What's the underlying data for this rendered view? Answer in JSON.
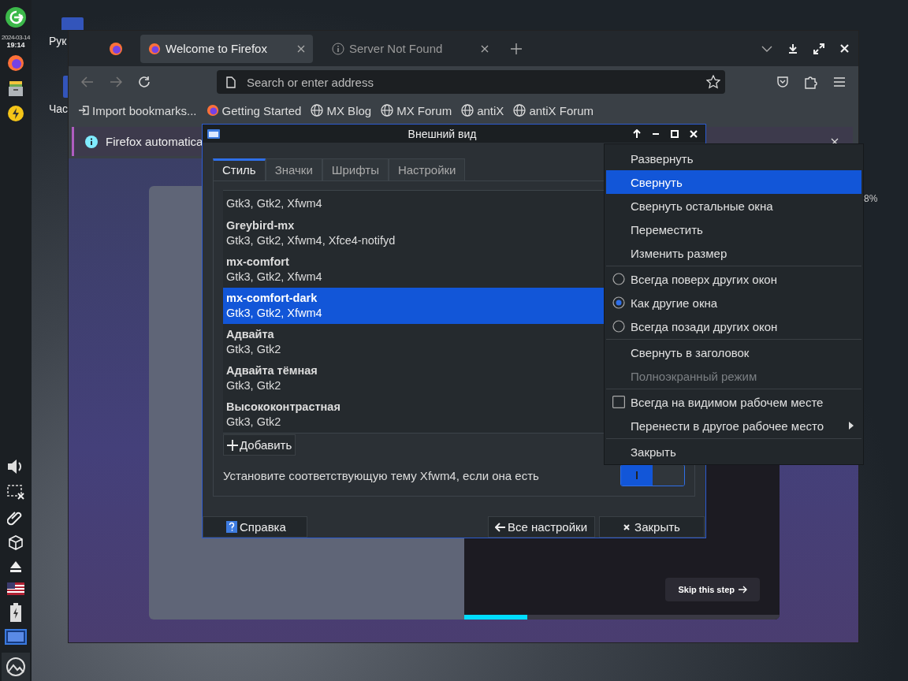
{
  "panel": {
    "date": "2024-03-14",
    "time": "19:14"
  },
  "desktop_icons": [
    {
      "label": "Рук"
    },
    {
      "label": "Час"
    }
  ],
  "desktop_reading": "8%",
  "browser": {
    "tabs": [
      {
        "title": "Welcome to Firefox",
        "selected": true
      },
      {
        "title": "Server Not Found",
        "selected": false
      }
    ],
    "address": {
      "placeholder": "Search or enter address"
    },
    "bookmarks": [
      {
        "label": "Import bookmarks...",
        "kind": "import"
      },
      {
        "label": "Getting Started",
        "kind": "firefox"
      },
      {
        "label": "MX Blog",
        "kind": "globe"
      },
      {
        "label": "MX Forum",
        "kind": "globe"
      },
      {
        "label": "antiX",
        "kind": "globe"
      },
      {
        "label": "antiX Forum",
        "kind": "globe"
      }
    ],
    "notification": "Firefox automatica",
    "skip_button": "Skip this step",
    "progress": {
      "level": 0.2
    }
  },
  "dialog": {
    "title": "Внешний вид",
    "tabs": [
      {
        "label": "Стиль",
        "selected": true
      },
      {
        "label": "Значки",
        "selected": false
      },
      {
        "label": "Шрифты",
        "selected": false
      },
      {
        "label": "Настройки",
        "selected": false
      }
    ],
    "themes": [
      {
        "components": "Gtk3, Gtk2, Xfwm4",
        "selected": false
      },
      {
        "name": "Greybird-mx",
        "components": "Gtk3, Gtk2, Xfwm4, Xfce4-notifyd",
        "selected": false
      },
      {
        "name": "mx-comfort",
        "components": "Gtk3, Gtk2, Xfwm4",
        "selected": false
      },
      {
        "name": "mx-comfort-dark",
        "components": "Gtk3, Gtk2, Xfwm4",
        "selected": true
      },
      {
        "name": "Адвайта",
        "components": "Gtk3, Gtk2",
        "selected": false
      },
      {
        "name": "Адвайта тёмная",
        "components": "Gtk3, Gtk2",
        "selected": false
      },
      {
        "name": "Высококонтрастная",
        "components": "Gtk3, Gtk2",
        "selected": false
      }
    ],
    "add_button": "Добавить",
    "xfwm_option": {
      "label": "Установите соответствующую тему Xfwm4, если она есть",
      "on": true
    },
    "buttons": {
      "help": "Справка",
      "all_settings": "Все настройки",
      "close": "Закрыть"
    }
  },
  "menu": [
    {
      "kind": "item",
      "label": "Развернуть",
      "selected": false,
      "disabled": false
    },
    {
      "kind": "item",
      "label": "Свернуть",
      "selected": true,
      "disabled": false
    },
    {
      "kind": "item",
      "label": "Свернуть остальные окна",
      "selected": false,
      "disabled": false
    },
    {
      "kind": "item",
      "label": "Переместить",
      "selected": false,
      "disabled": false
    },
    {
      "kind": "item",
      "label": "Изменить размер",
      "selected": false,
      "disabled": false
    },
    {
      "kind": "separator"
    },
    {
      "kind": "radio",
      "label": "Всегда поверх других окон",
      "checked": false,
      "selected": false,
      "disabled": false
    },
    {
      "kind": "radio",
      "label": "Как другие окна",
      "checked": true,
      "selected": false,
      "disabled": false
    },
    {
      "kind": "radio",
      "label": "Всегда позади других окон",
      "checked": false,
      "selected": false,
      "disabled": false
    },
    {
      "kind": "separator"
    },
    {
      "kind": "item",
      "label": "Свернуть в заголовок",
      "selected": false,
      "disabled": false
    },
    {
      "kind": "item",
      "label": "Полноэкранный режим",
      "selected": false,
      "disabled": true
    },
    {
      "kind": "separator"
    },
    {
      "kind": "check",
      "label": "Всегда на видимом рабочем месте",
      "checked": false,
      "selected": false,
      "disabled": false
    },
    {
      "kind": "submenu",
      "label": "Перенести в другое рабочее место",
      "selected": false,
      "disabled": false
    },
    {
      "kind": "separator"
    },
    {
      "kind": "item",
      "label": "Закрыть",
      "selected": false,
      "disabled": false
    }
  ]
}
